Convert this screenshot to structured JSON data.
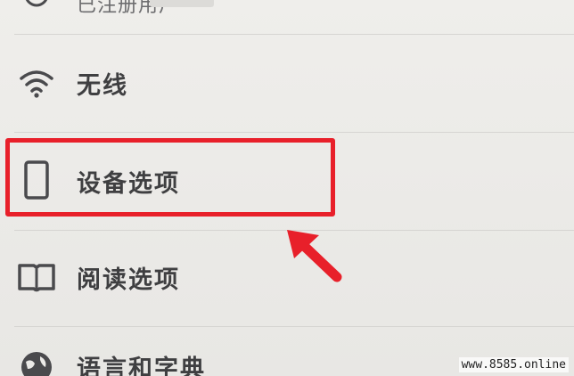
{
  "settings": {
    "items": [
      {
        "label": "已注册用户",
        "icon": "user-icon"
      },
      {
        "label": "无线",
        "icon": "wifi-icon"
      },
      {
        "label": "设备选项",
        "icon": "device-icon"
      },
      {
        "label": "阅读选项",
        "icon": "book-icon"
      },
      {
        "label": "语言和字典",
        "icon": "globe-icon"
      }
    ]
  },
  "annotation": {
    "highlight_color": "#e8202a",
    "highlighted_item": "设备选项"
  },
  "watermark": {
    "text": "www.8585.online"
  }
}
